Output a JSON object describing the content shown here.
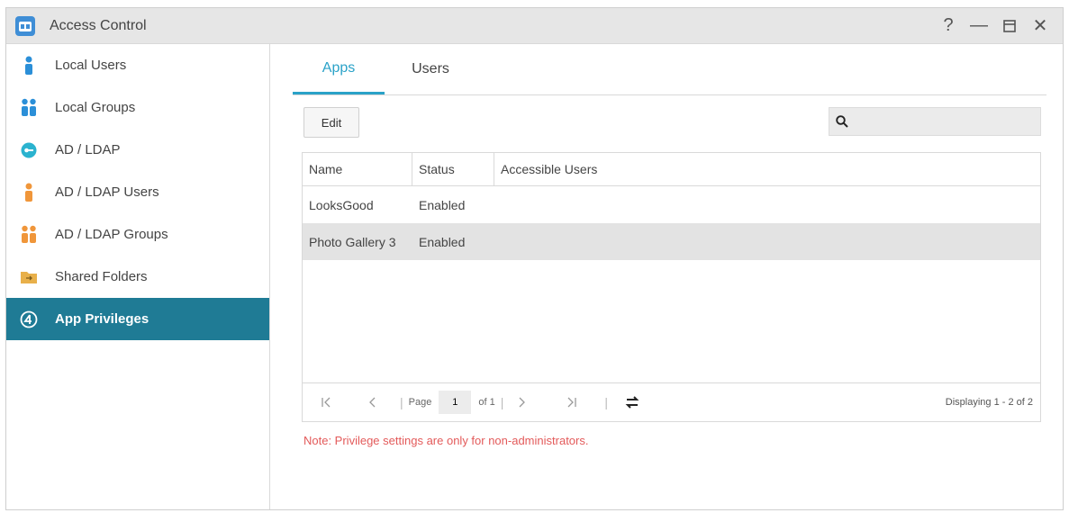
{
  "window": {
    "title": "Access Control",
    "help": "?",
    "minimize": "—",
    "close": "✕"
  },
  "sidebar": {
    "items": [
      {
        "label": "Local Users",
        "icon": "user-icon"
      },
      {
        "label": "Local Groups",
        "icon": "group-icon"
      },
      {
        "label": "AD / LDAP",
        "icon": "key-icon"
      },
      {
        "label": "AD / LDAP Users",
        "icon": "ad-user-icon"
      },
      {
        "label": "AD / LDAP Groups",
        "icon": "ad-group-icon"
      },
      {
        "label": "Shared Folders",
        "icon": "folder-icon"
      },
      {
        "label": "App Privileges",
        "icon": "app-privileges-icon",
        "active": true
      }
    ]
  },
  "tabs": [
    {
      "label": "Apps",
      "active": true
    },
    {
      "label": "Users",
      "active": false
    }
  ],
  "toolbar": {
    "edit_label": "Edit",
    "search_value": ""
  },
  "grid": {
    "columns": [
      "Name",
      "Status",
      "Accessible Users"
    ],
    "rows": [
      {
        "name": "LooksGood",
        "status": "Enabled",
        "users": ""
      },
      {
        "name": "Photo Gallery 3",
        "status": "Enabled",
        "users": "",
        "selected": true
      }
    ]
  },
  "pager": {
    "page_label": "Page",
    "page_value": "1",
    "of_label": "of 1",
    "displaying": "Displaying 1 - 2 of 2"
  },
  "note": "Note: Privilege settings are only for non-administrators.",
  "colors": {
    "accent": "#2aa2c8",
    "sidebar_active": "#1f7b95",
    "note": "#e35a5a"
  }
}
